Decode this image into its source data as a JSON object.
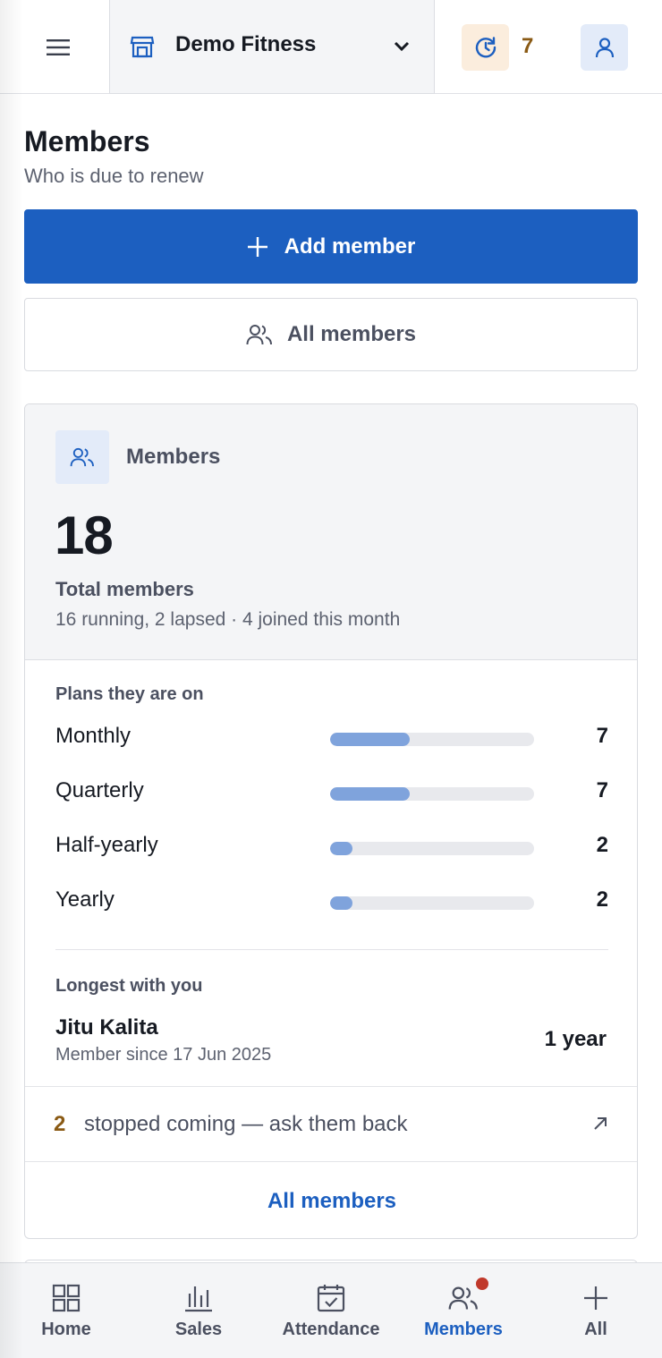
{
  "header": {
    "gym_name": "Demo Fitness",
    "renew_count": "7",
    "icons": {
      "menu": "menu-icon",
      "store": "store-icon",
      "chevron": "chevron-down-icon",
      "renew": "renew-clock-icon",
      "profile": "user-icon"
    }
  },
  "page": {
    "title": "Members",
    "subtitle": "Who is due to renew",
    "add_button": "Add member",
    "all_button": "All members"
  },
  "card": {
    "label": "Members",
    "total": "18",
    "total_label": "Total members",
    "total_sub": "16 running, 2 lapsed · 4 joined this month",
    "plans_heading": "Plans they are on",
    "plans": [
      {
        "name": "Monthly",
        "value": "7",
        "fraction": 0.389
      },
      {
        "name": "Quarterly",
        "value": "7",
        "fraction": 0.389
      },
      {
        "name": "Half-yearly",
        "value": "2",
        "fraction": 0.111
      },
      {
        "name": "Yearly",
        "value": "2",
        "fraction": 0.111
      }
    ],
    "longest_heading": "Longest with you",
    "longest_name": "Jitu Kalita",
    "longest_since": "Member since 17 Jun 2025",
    "longest_duration": "1 year",
    "stopped_count": "2",
    "stopped_text": "stopped coming — ask them back",
    "footer_link": "All members"
  },
  "nav": {
    "items": [
      {
        "label": "Home",
        "icon": "grid-icon"
      },
      {
        "label": "Sales",
        "icon": "bar-chart-icon"
      },
      {
        "label": "Attendance",
        "icon": "calendar-check-icon"
      },
      {
        "label": "Members",
        "icon": "users-icon",
        "active": true
      },
      {
        "label": "All",
        "icon": "plus-icon"
      }
    ]
  },
  "colors": {
    "primary": "#1c5fc0",
    "accent_amber": "#8a5a14",
    "bar_fill": "#7fa3dc",
    "notification_dot": "#c0392b"
  }
}
